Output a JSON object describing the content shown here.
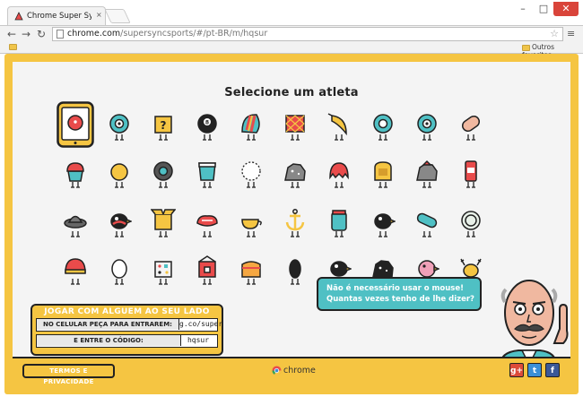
{
  "browser": {
    "tab_title": "Chrome Super Sync Sport",
    "tab_close": "×",
    "window_min": "–",
    "window_max": "□",
    "window_close": "✕",
    "url_host": "chrome.com",
    "url_path": "/supersyncsports/#/pt-BR/m/hqsur",
    "bookmark_other": "Outros favoritos"
  },
  "page": {
    "heading": "Selecione um atleta",
    "join_title": "JOGAR COM ALGUEM AO SEU LADO",
    "join_row1_label": "NO CELULAR PEÇA PARA ENTRAREM:",
    "join_row1_value": "g.co/super",
    "join_row2_label": "E ENTRE O CÓDIGO:",
    "join_row2_value": "hqsur",
    "bubble_line1": "Não é necessário usar o mouse!",
    "bubble_line2": "Quantas vezes tenho de lhe dizer?",
    "terms_label": "TERMOS E PRIVACIDADE",
    "brand_label": "chrome"
  },
  "athletes": [
    {
      "name": "tablet",
      "color": "#e94b4b"
    },
    {
      "name": "eyeball",
      "color": "#4fc0c4"
    },
    {
      "name": "question-box",
      "color": "#f5c542"
    },
    {
      "name": "eight-ball",
      "color": "#222222"
    },
    {
      "name": "striped-shell",
      "color": "#e94b4b"
    },
    {
      "name": "patterned-box",
      "color": "#e94b4b"
    },
    {
      "name": "banana",
      "color": "#f5c542"
    },
    {
      "name": "donut",
      "color": "#4fc0c4"
    },
    {
      "name": "target-donut",
      "color": "#4fc0c4"
    },
    {
      "name": "capsule",
      "color": "#f0b8a0"
    },
    {
      "name": "cupcake",
      "color": "#4fc0c4"
    },
    {
      "name": "yellow-ball",
      "color": "#f5c542"
    },
    {
      "name": "camera",
      "color": "#555555"
    },
    {
      "name": "cup",
      "color": "#4fc0c4"
    },
    {
      "name": "dotted-circle",
      "color": "#ffffff"
    },
    {
      "name": "rock",
      "color": "#888888"
    },
    {
      "name": "jellyfish",
      "color": "#e94b4b"
    },
    {
      "name": "toast",
      "color": "#f5c542"
    },
    {
      "name": "volcano",
      "color": "#888888"
    },
    {
      "name": "soda-can",
      "color": "#e94b4b"
    },
    {
      "name": "saucer",
      "color": "#666666"
    },
    {
      "name": "mustache-bird",
      "color": "#222222"
    },
    {
      "name": "open-box",
      "color": "#f5c542"
    },
    {
      "name": "steak",
      "color": "#e94b4b"
    },
    {
      "name": "tea-cup",
      "color": "#f5c542"
    },
    {
      "name": "anchor",
      "color": "#f5c542"
    },
    {
      "name": "jar",
      "color": "#4fc0c4"
    },
    {
      "name": "magpie",
      "color": "#222222"
    },
    {
      "name": "pickle",
      "color": "#4fc0c4"
    },
    {
      "name": "lime-slice",
      "color": "#e8f0e8"
    },
    {
      "name": "helmet",
      "color": "#e94b4b"
    },
    {
      "name": "egg",
      "color": "#ffffff"
    },
    {
      "name": "dice-box",
      "color": "#f4f4f4"
    },
    {
      "name": "house-box",
      "color": "#e94b4b"
    },
    {
      "name": "cake-slice",
      "color": "#f5a742"
    },
    {
      "name": "black-bean",
      "color": "#222222"
    },
    {
      "name": "black-bird",
      "color": "#222222"
    },
    {
      "name": "dark-rock",
      "color": "#222222"
    },
    {
      "name": "pink-bird",
      "color": "#f0a0b8"
    },
    {
      "name": "moose",
      "color": "#f5c542"
    }
  ],
  "colors": {
    "frame_yellow": "#f5c542",
    "bubble_teal": "#4fc0c4",
    "ink": "#222222"
  }
}
